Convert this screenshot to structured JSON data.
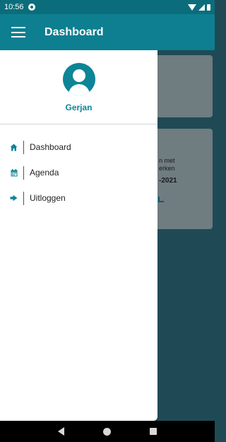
{
  "status_bar": {
    "time": "10:56"
  },
  "app_bar": {
    "title": "Dashboard"
  },
  "background": {
    "card_text_line1": "n met",
    "card_text_line2": "erken",
    "card_date": "-2021"
  },
  "drawer": {
    "user_name": "Gerjan",
    "items": [
      {
        "label": "Dashboard",
        "icon": "home-icon"
      },
      {
        "label": "Agenda",
        "icon": "calendar-icon"
      },
      {
        "label": "Uitloggen",
        "icon": "sign-out-icon"
      }
    ]
  },
  "colors": {
    "primary": "#0d7f90",
    "accent": "#0d8596",
    "status_bar": "#0b6d7b"
  }
}
